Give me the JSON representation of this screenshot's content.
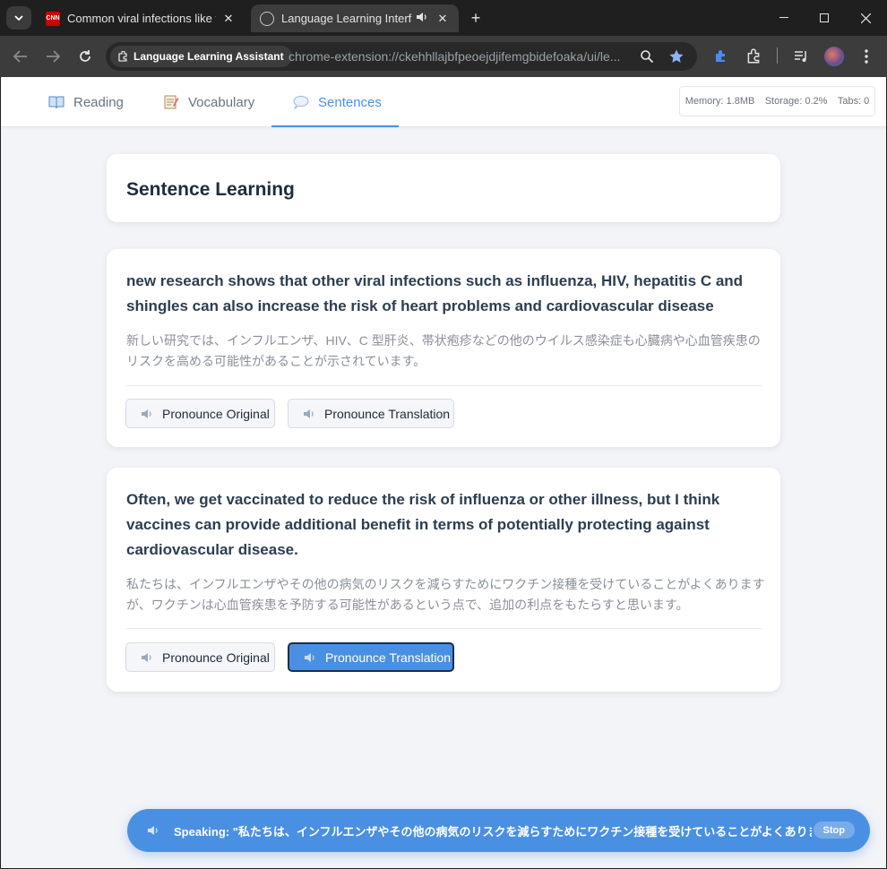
{
  "browser": {
    "tabs": [
      {
        "title": "Common viral infections like flu",
        "favicon": "CNN"
      },
      {
        "title": "Language Learning Interface"
      }
    ],
    "site_chip": "Language Learning Assistant",
    "url": "chrome-extension://ckehhllajbfpeoejdjifemgbidefoaka/ui/le..."
  },
  "nav": {
    "tabs": [
      {
        "label": "Reading",
        "icon": "book-icon"
      },
      {
        "label": "Vocabulary",
        "icon": "memo-icon"
      },
      {
        "label": "Sentences",
        "icon": "speech-bubble-icon"
      }
    ],
    "active_tab": "Sentences",
    "stats": {
      "memory": "Memory: 1.8MB",
      "storage": "Storage: 0.2%",
      "tabs": "Tabs: 0"
    }
  },
  "main": {
    "title": "Sentence Learning",
    "sentences": [
      {
        "original": "new research shows that other viral infections such as influenza, HIV, hepatitis C and shingles can also increase the risk of heart problems and cardiovascular disease",
        "translation": "新しい研究では、インフルエンザ、HIV、C 型肝炎、帯状疱疹などの他のウイルス感染症も心臓病や心血管疾患のリスクを高める可能性があることが示されています。",
        "pronounce_original": "Pronounce Original",
        "pronounce_translation": "Pronounce Translation"
      },
      {
        "original": "Often, we get vaccinated to reduce the risk of influenza or other illness, but I think vaccines can provide additional benefit in terms of potentially protecting against cardiovascular disease.",
        "translation": "私たちは、インフルエンザやその他の病気のリスクを減らすためにワクチン接種を受けていることがよくありますが、ワクチンは心血管疾患を予防する可能性があるという点で、追加の利点をもたらすと思います。",
        "pronounce_original": "Pronounce Original",
        "pronounce_translation": "Pronounce Translation"
      }
    ]
  },
  "speaking": {
    "text": "Speaking: \"私たちは、インフルエンザやその他の病気のリスクを減らすためにワクチン接種を受けていることがよくありま...\"",
    "stop_label": "Stop"
  },
  "colors": {
    "accent": "#4a90e2",
    "page_bg": "#f3f4f8",
    "title": "#1f2d3d"
  }
}
